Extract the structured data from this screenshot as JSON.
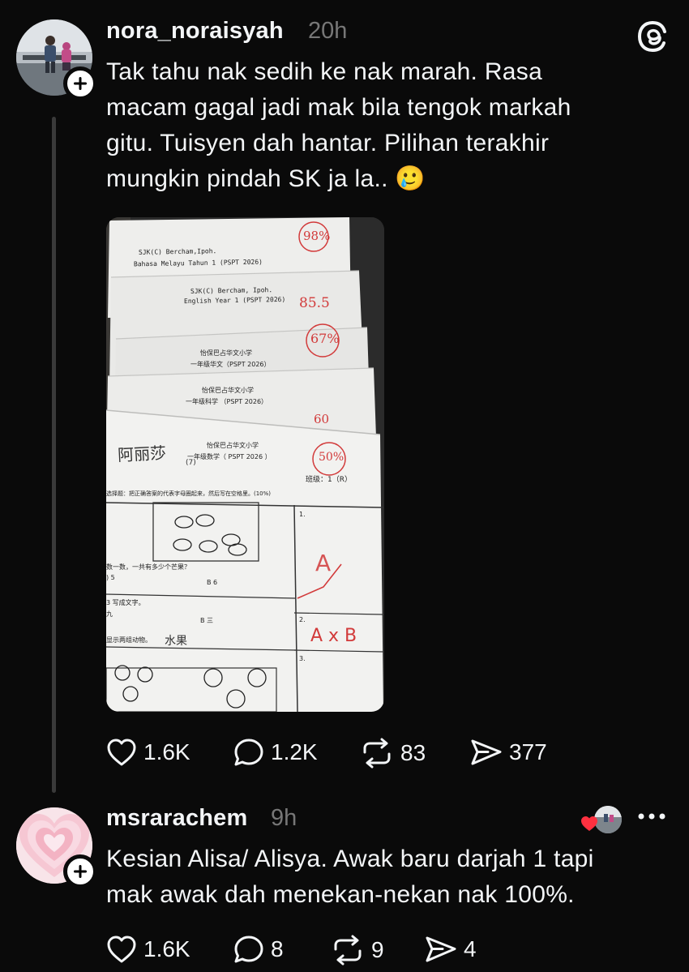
{
  "app": {
    "logo_icon": "threads-logo-icon"
  },
  "main_post": {
    "username": "nora_noraisyah",
    "time": "20h",
    "text": "Tak tahu nak sedih ke nak marah. Rasa macam gagal jadi mak bila tengok markah gitu. Tuisyen dah hantar. Pilihan terakhir mungkin pindah SK ja la.. 🥲",
    "lines": [
      "Tak tahu nak sedih ke nak marah. Rasa",
      "macam gagal jadi mak bila tengok markah",
      "gitu. Tuisyen dah hantar. Pilihan terakhir",
      "mungkin pindah SK ja la.. 🥲"
    ],
    "photo": {
      "paper1_school": "SJK(C) Bercham,Ipoh.",
      "paper1_subject": "Bahasa Melayu Tahun 1 (PSPT 2026)",
      "paper1_score": "98%",
      "paper2_school": "SJK(C) Bercham, Ipoh.",
      "paper2_subject": "English Year 1 (PSPT 2026)",
      "paper2_score": "85.5",
      "paper2_percent": "67%",
      "paper3_school": "怡保巴占华文小学",
      "paper3_subject": "一年级华文（PSPT 2026）",
      "paper4_school": "怡保巴占华文小学",
      "paper4_subject": "一年级科学 （PSPT 2026）",
      "paper4_score": "60",
      "paper5_school": "怡保巴占华文小学",
      "paper5_subject": "一年级数学（ PSPT 2026 ）",
      "paper5_score": "50%",
      "paper5_name": "阿丽莎",
      "paper5_number": "(7)",
      "paper5_class": "班级：1（R）",
      "paper5_instruction": "选择题：把正确答案的代表字母圈起来，然后写在空格里。(10%)",
      "q1_text": "数一数，一共有多少个芒果？",
      "q1_a": ") 5",
      "q1_b": "B 6",
      "q1_num": "1.",
      "q1_ans": "A",
      "q2_text": "3 写成文字。",
      "q2_a": "九",
      "q2_b": "B 三",
      "q2_num": "2.",
      "q2_ans": "A x B",
      "q3_text": "显示两组动物。",
      "q3_hand": "水果",
      "q3_num": "3."
    },
    "actions": {
      "likes": "1.6K",
      "replies": "1.2K",
      "reposts": "83",
      "shares": "377"
    }
  },
  "reply": {
    "username": "msrarachem",
    "time": "9h",
    "lines": [
      "Kesian Alisa/ Alisya. Awak baru darjah 1 tapi",
      "mak awak dah menekan-nekan nak 100%."
    ],
    "actions": {
      "likes": "1.6K",
      "replies": "8",
      "reposts": "9",
      "shares": "4"
    }
  },
  "colors": {
    "background": "#0a0a0a",
    "text": "#f3f5f7",
    "muted": "#777777",
    "liked": "#ff3040",
    "ink_red": "#d23a3a"
  }
}
